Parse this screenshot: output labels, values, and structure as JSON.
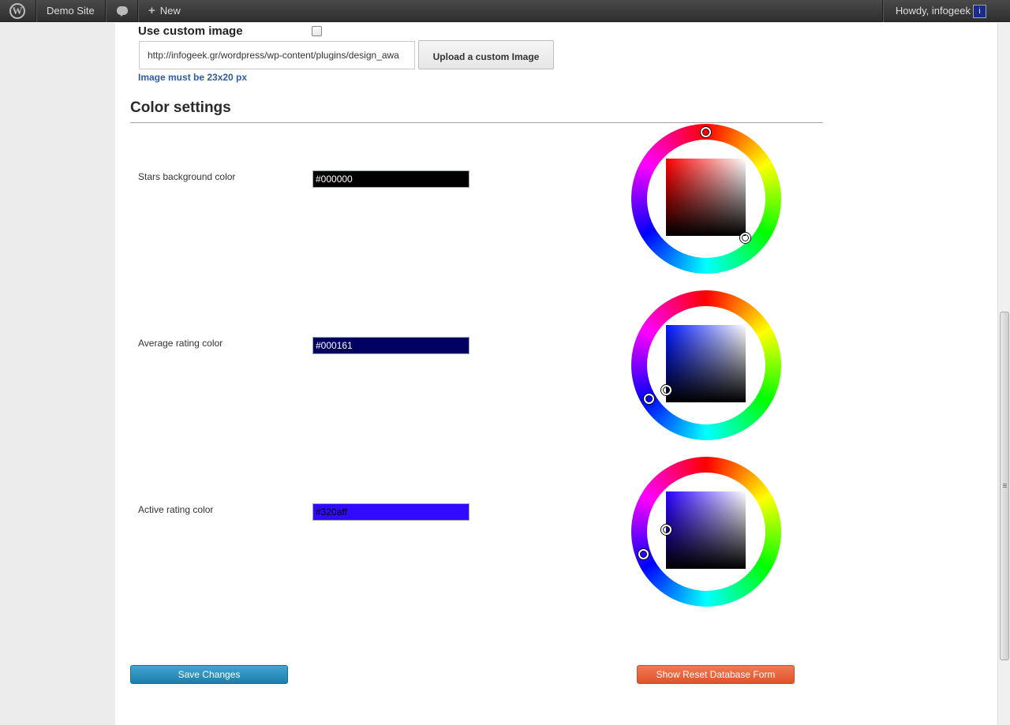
{
  "adminbar": {
    "site_name": "Demo Site",
    "new_label": "New",
    "howdy": "Howdy, infogeek"
  },
  "custom_image": {
    "label": "Use custom image",
    "checked": false,
    "url_value": "http://infogeek.gr/wordpress/wp-content/plugins/design_awa",
    "upload_label": "Upload a custom Image",
    "note": "Image must be 23x20 px"
  },
  "color_settings": {
    "title": "Color settings",
    "rows": [
      {
        "label": "Stars background color",
        "value": "#000000",
        "text_color": "#ffffff"
      },
      {
        "label": "Average rating color",
        "value": "#000161",
        "text_color": "#ffffff"
      },
      {
        "label": "Active rating color",
        "value": "#320aff",
        "text_color": "#000000"
      }
    ]
  },
  "buttons": {
    "save_label": "Save Changes",
    "reset_label": "Show Reset Database Form"
  },
  "colors": {
    "save_btn": "#2a8fbd",
    "reset_btn": "#e8663d",
    "admin_bar": "#3a3a3a",
    "note_text": "#2e5ba8"
  }
}
